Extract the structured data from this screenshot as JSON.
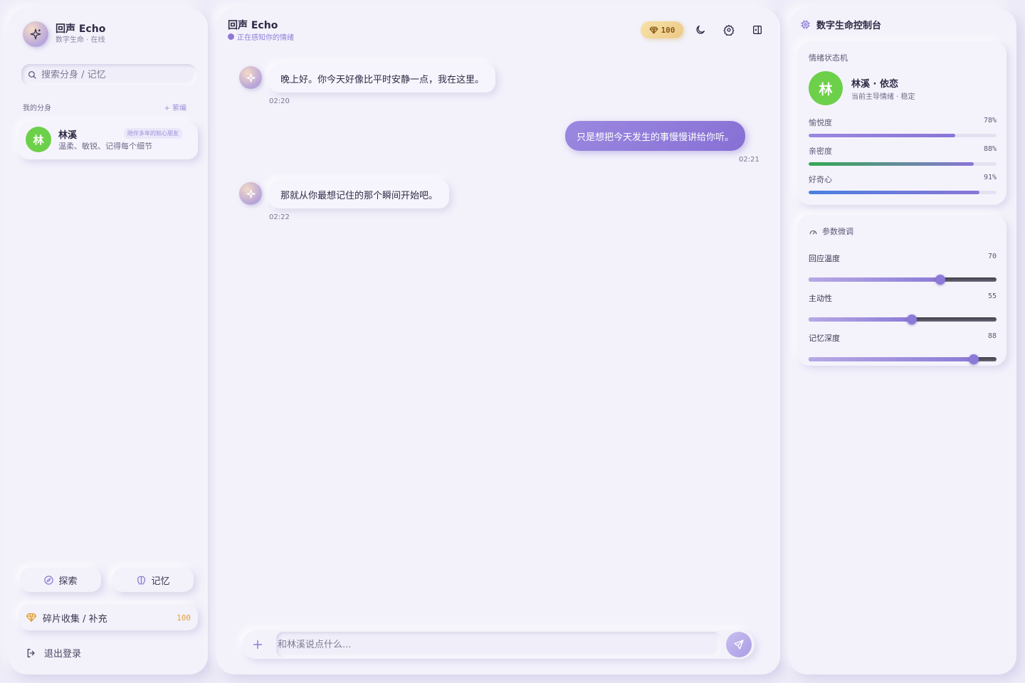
{
  "app": {
    "brand_title": "回声 Echo",
    "brand_subtitle": "数字生命 · 在线"
  },
  "sidebar": {
    "search_placeholder": "搜索分身 / 记忆",
    "section_title": "我的分身",
    "section_action": "+ 萦编",
    "personas": [
      {
        "avatar": "林",
        "name": "林溪",
        "tag": "陪伴多年的知心朋友",
        "desc": "温柔、敏锐、记得每个细节",
        "avatar_color": "#6dd04a"
      }
    ],
    "nav": {
      "explore_label": "探索",
      "memory_label": "记忆"
    },
    "shards_label": "碎片收集 / 补充",
    "shards_value": "100",
    "logout_label": "退出登录"
  },
  "chat": {
    "title": "回声 Echo",
    "status": "正在感知你的情绪",
    "gem_count": "100",
    "messages": [
      {
        "role": "bot",
        "text": "晚上好。你今天好像比平时安静一点，我在这里。",
        "time": "02:20"
      },
      {
        "role": "user",
        "text": "只是想把今天发生的事慢慢讲给你听。",
        "time": "02:21"
      },
      {
        "role": "bot",
        "text": "那就从你最想记住的那个瞬间开始吧。",
        "time": "02:22"
      }
    ],
    "input_placeholder": "和林溪说点什么..."
  },
  "console": {
    "title": "数字生命控制台",
    "emotion": {
      "heading": "情绪状态机",
      "avatar": "林",
      "name": "林溪 · 依恋",
      "subtitle": "当前主导情绪 · 稳定",
      "meters": [
        {
          "label": "愉悦度",
          "value": 78,
          "display": "78%",
          "color": "linear-gradient(90deg,#9b86e0,#8a76d6)"
        },
        {
          "label": "亲密度",
          "value": 88,
          "display": "88%",
          "color": "linear-gradient(90deg,#34a853,#8a76d6)"
        },
        {
          "label": "好奇心",
          "value": 91,
          "display": "91%",
          "color": "linear-gradient(90deg,#4a7fe0,#8a76d6)"
        }
      ]
    },
    "tuning": {
      "heading": "参数微调",
      "sliders": [
        {
          "label": "回应温度",
          "value": 70,
          "display": "70"
        },
        {
          "label": "主动性",
          "value": 55,
          "display": "55"
        },
        {
          "label": "记忆深度",
          "value": 88,
          "display": "88"
        }
      ]
    }
  },
  "colors": {
    "accent": "#8e7ad6",
    "gold": "#e2a23d",
    "avatar_green": "#6dd04a"
  }
}
